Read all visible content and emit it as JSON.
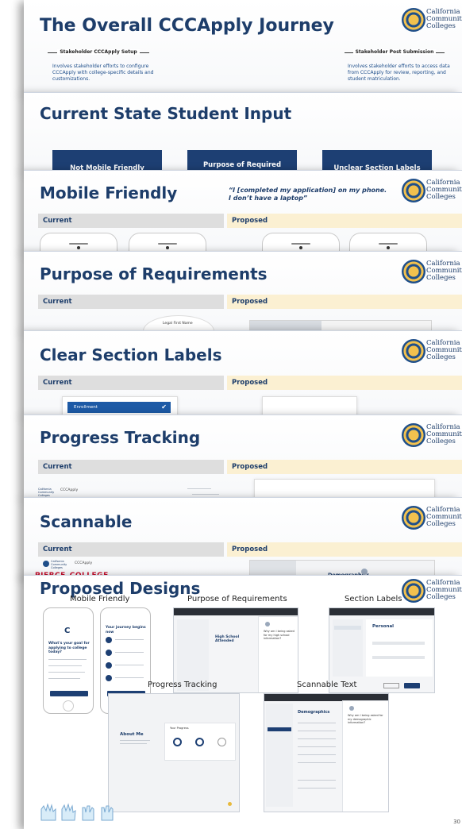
{
  "logo": {
    "line1": "California",
    "line2": "Community",
    "line3": "Colleges"
  },
  "slide1": {
    "title": "The Overall CCCApply Journey",
    "left_heading": "Stakeholder CCCApply Setup",
    "left_text": "Involves stakeholder efforts to configure CCCApply with college-specific details and customizations.",
    "right_heading": "Stakeholder Post Submission",
    "right_text": "Involves stakeholder efforts to access data from CCCApply for review, reporting, and student matriculation."
  },
  "slide2": {
    "title": "Current State Student Input",
    "tiles": [
      "Not Mobile Friendly",
      "Purpose of Required",
      "Unclear Section Labels"
    ]
  },
  "slide3": {
    "title": "Mobile Friendly",
    "quote": "“I [completed my application] on my phone. I don’t have a laptop”",
    "current": "Current",
    "proposed": "Proposed"
  },
  "slide4": {
    "title": "Purpose of Requirements",
    "current": "Current",
    "proposed": "Proposed",
    "field_label": "Legal First Name"
  },
  "slide5": {
    "title": "Clear Section Labels",
    "current": "Current",
    "proposed": "Proposed",
    "enrollment": "Enrollment"
  },
  "slide6": {
    "title": "Progress Tracking",
    "current": "Current",
    "proposed": "Proposed",
    "site_name": "CCCApply"
  },
  "slide7": {
    "title": "Scannable",
    "current": "Current",
    "proposed": "Proposed",
    "college_name": "PIERCE COLLEGE",
    "section": "Demographics"
  },
  "slide8": {
    "title": "Proposed Designs",
    "captions": [
      "Mobile Friendly",
      "Purpose of Requirements",
      "Section Labels",
      "Progress Tracking",
      "Scannable Text"
    ],
    "mobile_question": "What's your goal for applying to college today?",
    "mobile_heading": "Your journey begins now",
    "purpose_heading": "High School Attended",
    "purpose_side": "Why am I being asked for my high school information?",
    "section_heading": "Personal",
    "progress_heading": "About Me",
    "progress_sub": "Your Progress",
    "scan_heading": "Demographics",
    "scan_side": "Why am I being asked for my demographic information?",
    "page_number": "30"
  },
  "colors": {
    "navy": "#1d3d6a",
    "tile_blue": "#1d3f73",
    "current_bg": "#dedede",
    "proposed_bg": "#fbf0d2",
    "pierce_red": "#c8102e"
  }
}
